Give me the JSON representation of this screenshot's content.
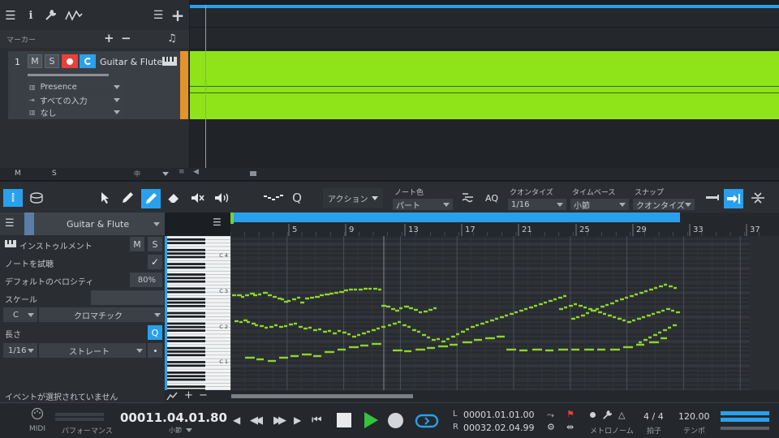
{
  "top_toolbar": {
    "icons": [
      "menu-icon",
      "info-icon",
      "wrench-icon",
      "automation-icon",
      "list-icon",
      "plus-icon"
    ]
  },
  "marker": {
    "label": "マーカー",
    "add": "+",
    "remove": "−"
  },
  "track": {
    "number": "1",
    "mute": "M",
    "solo": "S",
    "name": "Guitar & Flute",
    "preset": "Presence",
    "input": "すべての入力",
    "output": "なし"
  },
  "mix_bar": {
    "m": "M",
    "s": "S",
    "mid": "中"
  },
  "edit_toolbar": {
    "action_label": "アクション",
    "note_color_label": "ノート色",
    "note_color_value": "パート",
    "aq": "AQ",
    "quantize_label": "クオンタイズ",
    "quantize_value": "1/16",
    "timebase_label": "タイムベース",
    "timebase_value": "小節",
    "snap_label": "スナップ",
    "snap_value": "クオンタイズ"
  },
  "editor": {
    "track_name": "Guitar & Flute",
    "instrument_label": "インストゥルメント",
    "m": "M",
    "s": "S",
    "audition_label": "ノートを試聴",
    "velocity_label": "デフォルトのベロシティ",
    "velocity_value": "80%",
    "scale_label": "スケール",
    "scale_root": "C",
    "scale_type": "クロマチック",
    "length_label": "長さ",
    "length_q": "Q",
    "length_value": "1/16",
    "length_type": "ストレート",
    "status": "イベントが選択されていません"
  },
  "ruler": {
    "marks": [
      "5",
      "9",
      "13",
      "17",
      "21",
      "25",
      "29",
      "33",
      "37"
    ]
  },
  "octaves": [
    "C 4",
    "C 3",
    "C 2",
    "C 1"
  ],
  "transport": {
    "midi": "MIDI",
    "performance": "パフォーマンス",
    "position": "00011.04.01.80",
    "position_unit": "小節",
    "left_label": "L",
    "left_value": "00001.01.01.00",
    "right_label": "R",
    "right_value": "00032.02.04.99",
    "metronome": "メトロノーム",
    "signature": "4 / 4",
    "signature_label": "拍子",
    "tempo": "120.00",
    "tempo_label": "テンポ"
  },
  "colors": {
    "accent": "#2aa0ec",
    "clip": "#8ee319",
    "note": "#8ed42a",
    "record": "#e8403a",
    "play": "#34c33a"
  }
}
